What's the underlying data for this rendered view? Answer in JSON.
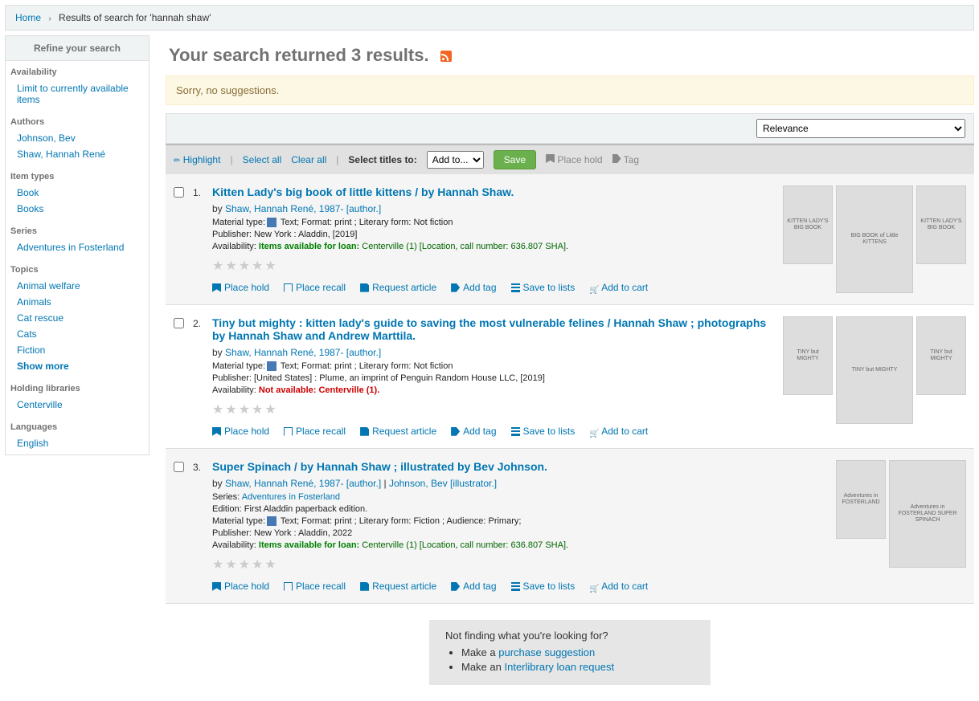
{
  "breadcrumb": {
    "home": "Home",
    "current": "Results of search for 'hannah shaw'"
  },
  "sidebar": {
    "title": "Refine your search",
    "groups": [
      {
        "title": "Availability",
        "items": [
          "Limit to currently available items"
        ]
      },
      {
        "title": "Authors",
        "items": [
          "Johnson, Bev",
          "Shaw, Hannah René"
        ]
      },
      {
        "title": "Item types",
        "items": [
          "Book",
          "Books"
        ]
      },
      {
        "title": "Series",
        "items": [
          "Adventures in Fosterland"
        ]
      },
      {
        "title": "Topics",
        "items": [
          "Animal welfare",
          "Animals",
          "Cat rescue",
          "Cats",
          "Fiction"
        ],
        "show_more": "Show more"
      },
      {
        "title": "Holding libraries",
        "items": [
          "Centerville"
        ]
      },
      {
        "title": "Languages",
        "items": [
          "English"
        ]
      }
    ]
  },
  "header": "Your search returned 3 results.",
  "alert": "Sorry, no suggestions.",
  "sort_select": "Relevance",
  "action_bar": {
    "highlight": "Highlight",
    "select_all": "Select all",
    "clear_all": "Clear all",
    "select_titles": "Select titles to:",
    "add_to": "Add to...",
    "save": "Save",
    "place_hold": "Place hold",
    "tag": "Tag"
  },
  "result_actions": {
    "place_hold": "Place hold",
    "place_recall": "Place recall",
    "request_article": "Request article",
    "add_tag": "Add tag",
    "save_lists": "Save to lists",
    "add_cart": "Add to cart"
  },
  "results": [
    {
      "num": "1.",
      "title": "Kitten Lady's big book of little kittens / by Hannah Shaw.",
      "by": "by ",
      "author": "Shaw, Hannah René, 1987- [author.]",
      "material": "Material type:",
      "text_label": " Text",
      "format": "; Format: ",
      "format_val": "print ",
      "literary": "; Literary form: ",
      "literary_val": "Not fiction",
      "publisher_label": "Publisher: ",
      "publisher": "New York : Aladdin, [2019]",
      "avail_label": "Availability: ",
      "avail_status": "Items available for loan: ",
      "avail_loc": "Centerville (1) ",
      "avail_call": "[Location, call number: 636.807 SHA]",
      "avail_class": "green",
      "covers": [
        "KITTEN LADY'S BIG BOOK",
        "BIG BOOK of Little KITTENS",
        "KITTEN LADY'S BIG BOOK"
      ]
    },
    {
      "num": "2.",
      "title": "Tiny but mighty : kitten lady's guide to saving the most vulnerable felines / Hannah Shaw ; photographs by Hannah Shaw and Andrew Marttila.",
      "by": "by ",
      "author": "Shaw, Hannah René, 1987- [author.]",
      "material": "Material type:",
      "text_label": " Text",
      "format": "; Format: ",
      "format_val": "print ",
      "literary": "; Literary form: ",
      "literary_val": "Not fiction",
      "publisher_label": "Publisher: ",
      "publisher": "[United States] : Plume, an imprint of Penguin Random House LLC, [2019]",
      "avail_label": "Availability: ",
      "avail_status": "Not available: ",
      "avail_loc": "Centerville (1).",
      "avail_call": "",
      "avail_class": "red",
      "covers": [
        "TINY but MIGHTY",
        "TINY but MIGHTY",
        "TINY but MIGHTY"
      ]
    },
    {
      "num": "3.",
      "title": "Super Spinach / by Hannah Shaw ; illustrated by Bev Johnson.",
      "by": "by ",
      "author": "Shaw, Hannah René, 1987- [author.]",
      "author2_sep": " | ",
      "author2": "Johnson, Bev [illustrator.]",
      "series_label": "Series: ",
      "series": "Adventures in Fosterland",
      "edition_label": "Edition: ",
      "edition": "First Aladdin paperback edition.",
      "material": "Material type:",
      "text_label": " Text",
      "format": "; Format: ",
      "format_val": "print",
      "literary": " ; Literary form: ",
      "literary_val": "Fiction",
      "audience": " ; Audience: ",
      "audience_val": "Primary;",
      "publisher_label": "Publisher: ",
      "publisher": "New York : Aladdin, 2022",
      "avail_label": "Availability: ",
      "avail_status": "Items available for loan: ",
      "avail_loc": "Centerville (1) ",
      "avail_call": "[Location, call number: 636.807 SHA]",
      "avail_class": "green",
      "covers": [
        "Adventures in FOSTERLAND",
        "Adventures in FOSTERLAND SUPER SPINACH"
      ]
    }
  ],
  "not_finding": {
    "title": "Not finding what you're looking for?",
    "make_a": "Make a ",
    "purchase": "purchase suggestion",
    "make_an": "Make an ",
    "ill": "Interlibrary loan request"
  }
}
